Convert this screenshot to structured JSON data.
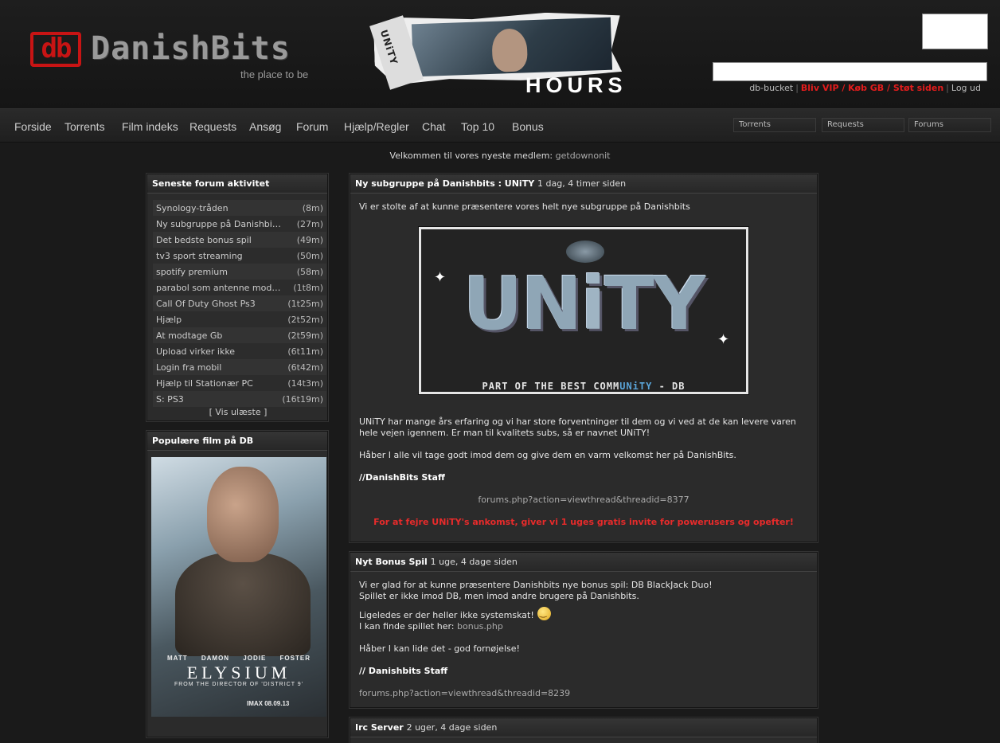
{
  "header": {
    "logo_letters": "db",
    "logo_name": "DanishBits",
    "logo_tagline": "the place to be",
    "banner_tab": "UNiTY",
    "banner_word": "HOURS",
    "user_links": [
      "db-bucket",
      "Bliv VIP / Køb GB / Støt siden",
      "Log ud"
    ]
  },
  "nav": {
    "items": [
      "Forside",
      "Torrents",
      "Film indeks",
      "Requests",
      "Ansøg",
      "Forum",
      "Hjælp/Regler",
      "Chat",
      "Top 10",
      "Bonus"
    ],
    "quick_search": [
      "Torrents",
      "Requests",
      "Forums"
    ]
  },
  "welcome": {
    "text": "Velkommen til vores nyeste medlem:",
    "user": "getdownonit"
  },
  "forum_activity": {
    "title": "Seneste forum aktivitet",
    "items": [
      {
        "title": "Synology-tråden",
        "time": "(8m)"
      },
      {
        "title": "Ny subgruppe på Danishbits :...",
        "time": "(27m)"
      },
      {
        "title": "Det bedste bonus spil",
        "time": "(49m)"
      },
      {
        "title": "tv3 sport streaming",
        "time": "(50m)"
      },
      {
        "title": "spotify premium",
        "time": "(58m)"
      },
      {
        "title": "parabol som antenne modtager...",
        "time": "(1t8m)"
      },
      {
        "title": "Call Of Duty Ghost Ps3",
        "time": "(1t25m)"
      },
      {
        "title": "Hjælp",
        "time": "(2t52m)"
      },
      {
        "title": "At modtage Gb",
        "time": "(2t59m)"
      },
      {
        "title": "Upload virker ikke",
        "time": "(6t11m)"
      },
      {
        "title": "Login fra mobil",
        "time": "(6t42m)"
      },
      {
        "title": "Hjælp til Stationær PC",
        "time": "(14t3m)"
      },
      {
        "title": "S: PS3",
        "time": "(16t19m)"
      }
    ],
    "more": "[ Vis ulæste ]"
  },
  "popular_films": {
    "title": "Populære film på DB",
    "poster": {
      "actors": "MATT DAMON JODIE FOSTER",
      "movie_title": "ELYSIUM",
      "subtitle": "FROM THE DIRECTOR OF 'DISTRICT 9'",
      "release": "IMAX 08.09.13"
    }
  },
  "news": [
    {
      "title": "Ny subgruppe på Danishbits : UNiTY",
      "time": "1 dag, 4 timer siden",
      "intro": "Vi er stolte af at kunne præsentere vores helt nye subgruppe på Danishbits",
      "logo_word_a": "UN",
      "logo_word_i": "i",
      "logo_word_b": "TY",
      "logo_tag_a": "PART OF THE BEST COMM",
      "logo_tag_b": "UNiTY",
      "logo_tag_c": " - DB",
      "para1": "UNiTY har mange års erfaring og vi har store forventninger til dem og vi ved at de kan levere varen hele vejen igennem. Er man til kvalitets subs, så er navnet UNiTY!",
      "para2": "Håber I alle vil tage godt imod dem og give dem en varm velkomst her på DanishBits.",
      "signature": "//DanishBits Staff",
      "link": "forums.php?action=viewthread&threadid=8377",
      "highlight": "For at fejre UNiTY's ankomst, giver vi 1 uges gratis invite for powerusers og opefter!"
    },
    {
      "title": "Nyt Bonus Spil",
      "time": "1 uge, 4 dage siden",
      "line1": "Vi er glad for at kunne præsentere Danishbits nye bonus spil: DB BlackJack Duo!",
      "line2": "Spillet er ikke imod DB, men imod andre brugere på Danishbits.",
      "line3": "Ligeledes er der heller ikke systemskat!",
      "line4_prefix": "I kan finde spillet her:",
      "line4_link": "bonus.php",
      "line5": "Håber I kan lide det - god fornøjelse!",
      "signature": "// Danishbits Staff",
      "link": "forums.php?action=viewthread&threadid=8239"
    },
    {
      "title": "Irc Server",
      "time": "2 uger, 4 dage siden"
    }
  ],
  "colors": {
    "accent_red": "#e21c1c",
    "unity_blue": "#5aa4d8"
  }
}
